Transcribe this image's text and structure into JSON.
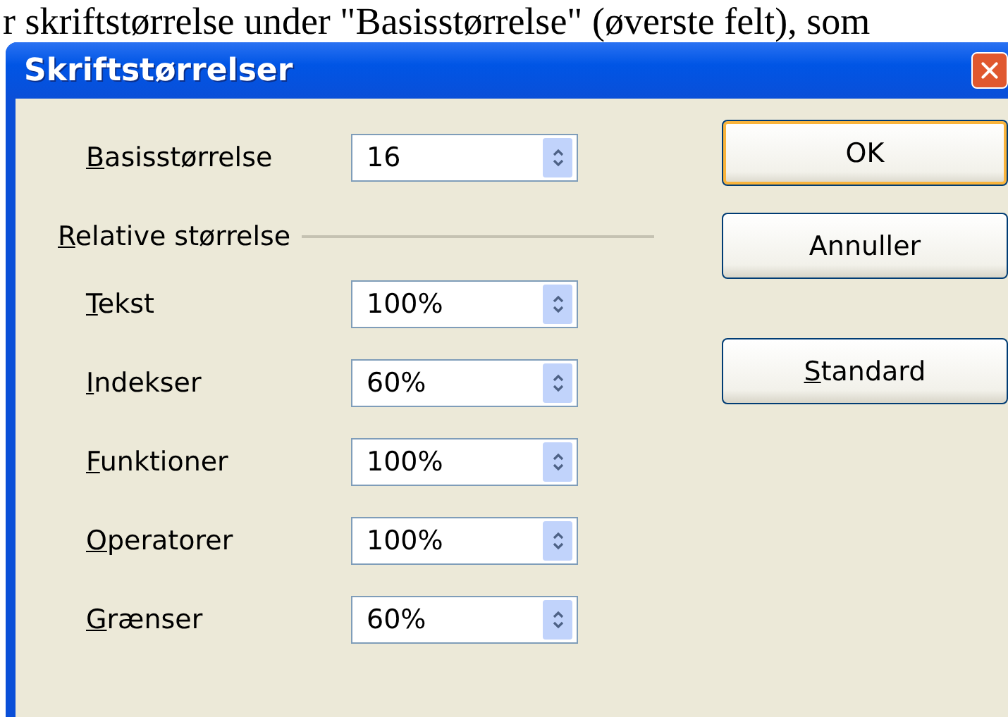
{
  "document_text": "r skriftstørrelse under \"Basisstørrelse\" (øverste felt), som",
  "window": {
    "title": "Skriftstørrelser"
  },
  "base_size": {
    "label": "Basisstørrelse",
    "underlined_first_letter": true,
    "value": "16"
  },
  "relative_section": {
    "heading": "Relative størrelse",
    "underlined_first_letter": true,
    "fields": [
      {
        "label": "Tekst",
        "underlined_first_letter": true,
        "value": "100%"
      },
      {
        "label": "Indekser",
        "underlined_first_letter": true,
        "value": "60%"
      },
      {
        "label": "Funktioner",
        "underlined_first_letter": true,
        "value": "100%"
      },
      {
        "label": "Operatorer",
        "underlined_first_letter": true,
        "value": "100%"
      },
      {
        "label": "Grænser",
        "underlined_first_letter": true,
        "value": "60%"
      }
    ]
  },
  "buttons": [
    {
      "label": "OK",
      "default": true,
      "underlined_first_letter": false
    },
    {
      "label": "Annuller",
      "default": false,
      "underlined_first_letter": false
    },
    {
      "label": "Standard",
      "default": false,
      "underlined_first_letter": true
    }
  ]
}
